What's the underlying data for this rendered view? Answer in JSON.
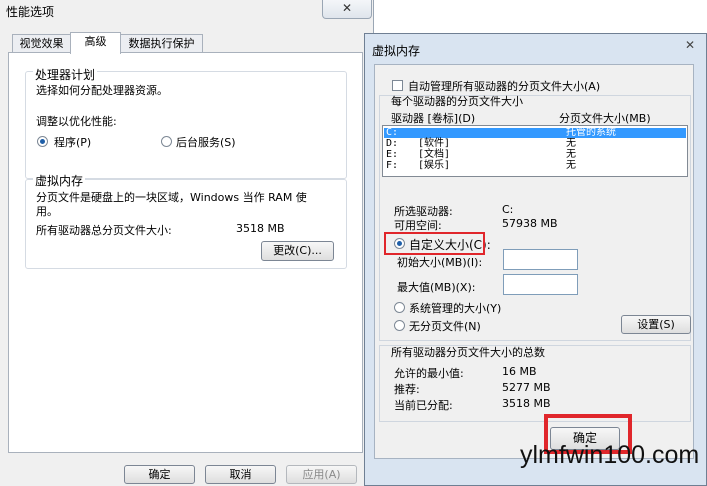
{
  "back_window": {
    "title": "性能选项",
    "close_glyph": "✕",
    "tabs": [
      "视觉效果",
      "高级",
      "数据执行保护"
    ],
    "processor": {
      "group_title": "处理器计划",
      "description": "选择如何分配处理器资源。",
      "adjust_label": "调整以优化性能:",
      "option_programs": "程序(P)",
      "option_background": "后台服务(S)",
      "selected": "程序(P)"
    },
    "virtual_memory": {
      "group_title": "虚拟内存",
      "description_line1": "分页文件是硬盘上的一块区域，Windows 当作 RAM 使",
      "description_line2": "用。",
      "total_label": "所有驱动器总分页文件大小:",
      "total_value": "3518 MB",
      "change_button": "更改(C)..."
    },
    "buttons": {
      "ok": "确定",
      "cancel": "取消",
      "apply": "应用(A)"
    }
  },
  "front_dialog": {
    "title": "虚拟内存",
    "close_glyph": "✕",
    "auto_manage_label": "自动管理所有驱动器的分页文件大小(A)",
    "auto_manage_checked": false,
    "per_drive_header": "每个驱动器的分页文件大小",
    "columns": {
      "drive": "驱动器 [卷标](D)",
      "size": "分页文件大小(MB)"
    },
    "drives": [
      {
        "drive": "C:",
        "label": "",
        "size": "托管的系统",
        "selected": true
      },
      {
        "drive": "D:",
        "label": "[软件]",
        "size": "无",
        "selected": false
      },
      {
        "drive": "E:",
        "label": "[文档]",
        "size": "无",
        "selected": false
      },
      {
        "drive": "F:",
        "label": "[娱乐]",
        "size": "无",
        "selected": false
      }
    ],
    "selected_drive_label": "所选驱动器:",
    "selected_drive_value": "C:",
    "free_space_label": "可用空间:",
    "free_space_value": "57938 MB",
    "custom_size_label": "自定义大小(C):",
    "initial_size_label": "初始大小(MB)(I):",
    "initial_size_value": "",
    "max_size_label": "最大值(MB)(X):",
    "max_size_value": "",
    "system_managed_label": "系统管理的大小(Y)",
    "no_paging_label": "无分页文件(N)",
    "size_option_selected": "自定义大小(C):",
    "set_button": "设置(S)",
    "totals_header": "所有驱动器分页文件大小的总数",
    "min_allowed_label": "允许的最小值:",
    "min_allowed_value": "16 MB",
    "recommended_label": "推荐:",
    "recommended_value": "5277 MB",
    "current_label": "当前已分配:",
    "current_value": "3518 MB",
    "ok_button": "确定"
  },
  "watermark": "ylmfwin100.com",
  "colors": {
    "highlight_red": "#e0262b",
    "selection_blue": "#3399ff",
    "radio_dot": "#1f5fa8"
  }
}
